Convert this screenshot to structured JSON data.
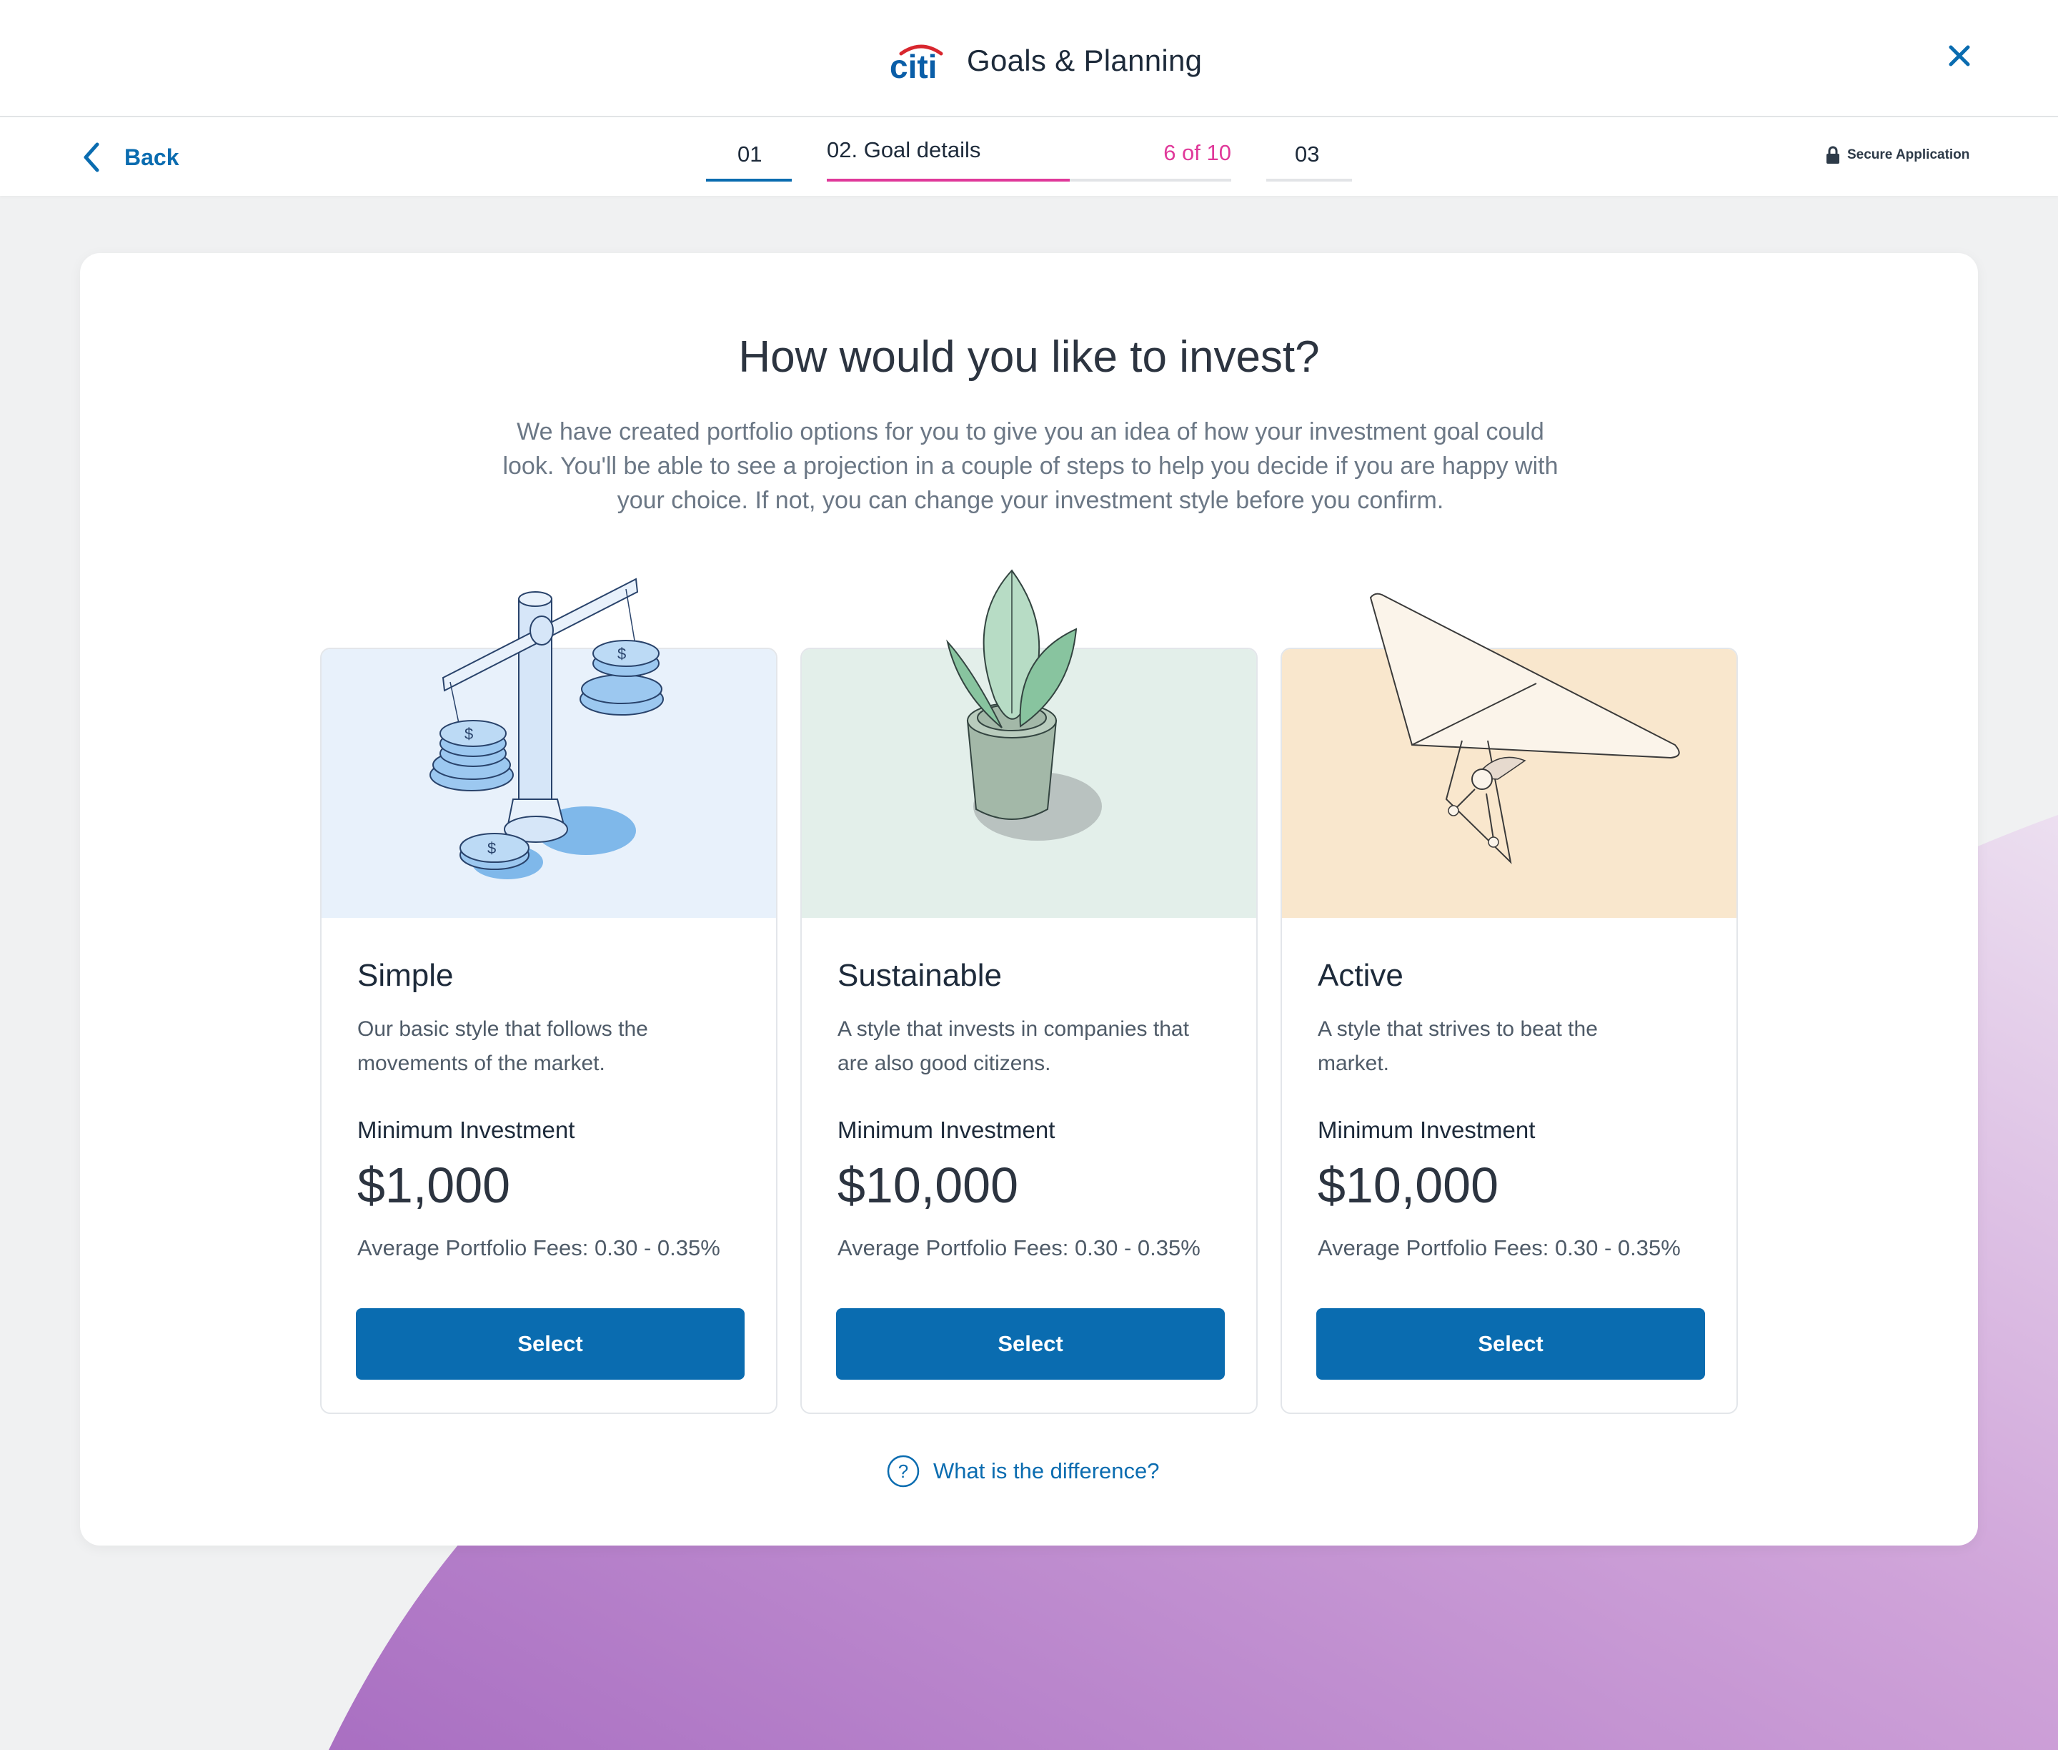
{
  "header": {
    "brand": "citi",
    "title": "Goals & Planning",
    "close_icon": "close-icon"
  },
  "subnav": {
    "back_label": "Back",
    "steps": [
      {
        "label": "01"
      },
      {
        "label": "02. Goal details",
        "count": "6 of 10",
        "progress": 0.6
      },
      {
        "label": "03"
      }
    ],
    "secure_label": "Secure Application"
  },
  "main": {
    "title": "How would you like to invest?",
    "description": "We have created portfolio options for you to give you an idea of how your investment goal could look. You'll be able to see a projection in a couple of steps to help you decide if you are happy with your choice. If not, you can change your investment style before you confirm.",
    "options": [
      {
        "name": "Simple",
        "description": "Our basic style that follows the movements of the market.",
        "min_label": "Minimum Investment",
        "min_value": "$1,000",
        "fees": "Average Portfolio Fees: 0.30 - 0.35%",
        "button": "Select",
        "illustration": "scale-coins-icon"
      },
      {
        "name": "Sustainable",
        "description": "A style that invests in companies that are also good citizens.",
        "min_label": "Minimum Investment",
        "min_value": "$10,000",
        "fees": "Average Portfolio Fees: 0.30 - 0.35%",
        "button": "Select",
        "illustration": "potted-plant-icon"
      },
      {
        "name": "Active",
        "description": "A style that strives to beat the market.",
        "min_label": "Minimum Investment",
        "min_value": "$10,000",
        "fees": "Average Portfolio Fees: 0.30 - 0.35%",
        "button": "Select",
        "illustration": "hang-glider-icon"
      }
    ],
    "difference_link": "What is the difference?"
  },
  "colors": {
    "primary": "#0a6cb0",
    "progress": "#e0399a",
    "simple_bg": "#e8f1fb",
    "sustainable_bg": "#e3efea",
    "active_bg": "#f9e7cd",
    "background_blob": "#b77dc8"
  }
}
